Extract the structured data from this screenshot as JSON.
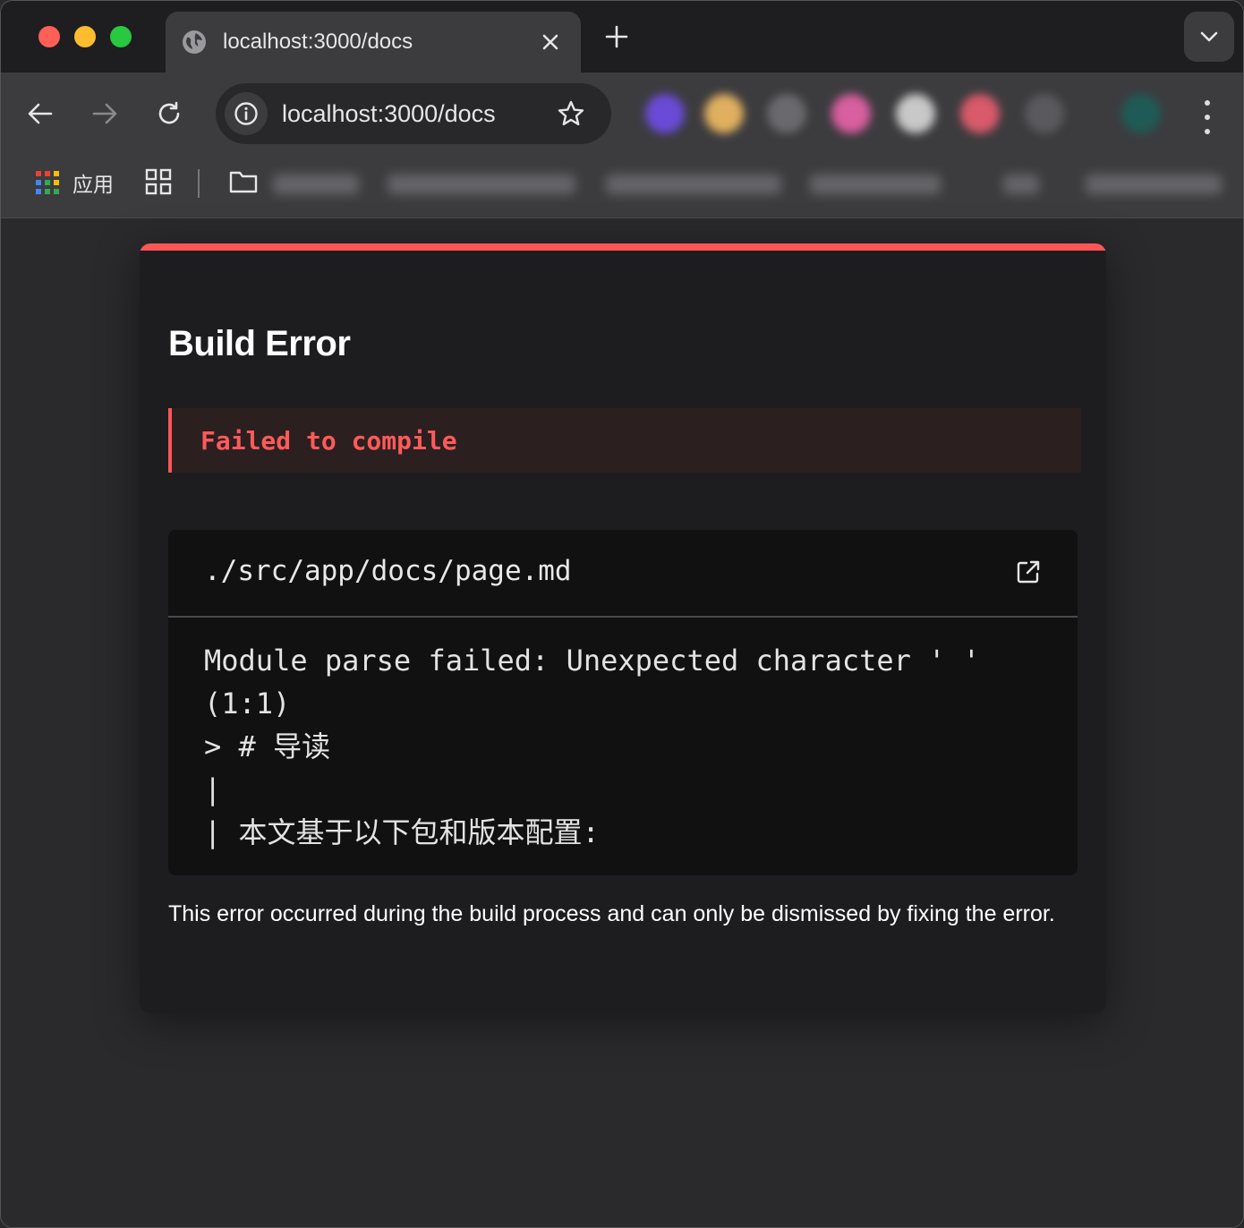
{
  "browser": {
    "tab_title": "localhost:3000/docs",
    "address": "localhost:3000/docs",
    "bookmarks": {
      "apps_label": "应用"
    },
    "icons": {
      "tab": "globe-icon",
      "close": "close-icon",
      "new_tab": "plus-icon",
      "tab_search": "chevron-down-icon",
      "back": "arrow-left-icon",
      "forward": "arrow-right-icon",
      "reload": "reload-icon",
      "site_info": "info-icon",
      "bookmark": "star-icon",
      "menu": "kebab-icon"
    }
  },
  "error_overlay": {
    "title": "Build Error",
    "subtitle": "Failed to compile",
    "file_path": "./src/app/docs/page.md",
    "message": "Module parse failed: Unexpected character ' '\n(1:1)\n> # 导读\n|\n| 本文基于以下包和版本配置:",
    "footer": "This error occurred during the build process and can only be dismissed by fixing the error.",
    "accent_color": "#ff5555"
  }
}
